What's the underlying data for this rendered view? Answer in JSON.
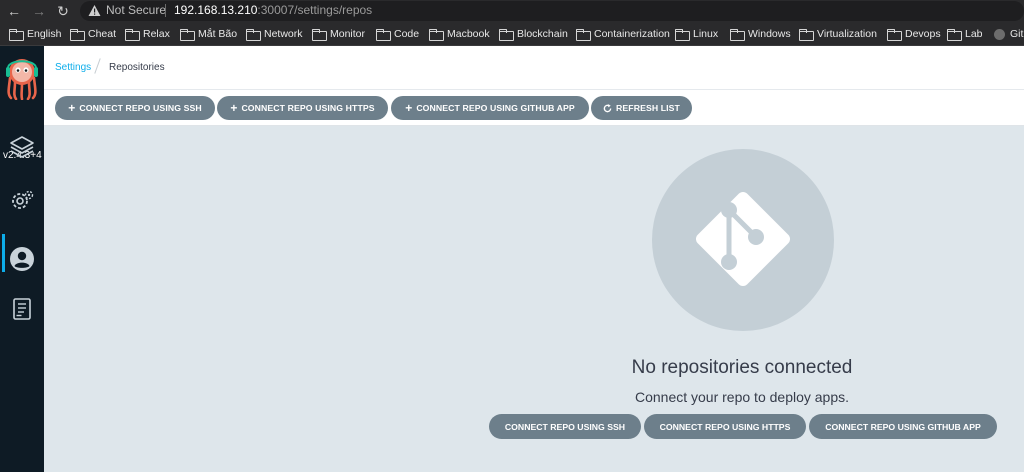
{
  "browser": {
    "security_label": "Not Secure",
    "url_host": "192.168.13.210",
    "url_rest": ":30007/settings/repos",
    "bookmarks": [
      {
        "label": "English",
        "icon": "folder-icon"
      },
      {
        "label": "Cheat",
        "icon": "folder-icon"
      },
      {
        "label": "Relax",
        "icon": "folder-icon"
      },
      {
        "label": "Mắt Bão",
        "icon": "folder-icon"
      },
      {
        "label": "Network",
        "icon": "folder-icon"
      },
      {
        "label": "Monitor",
        "icon": "folder-icon"
      },
      {
        "label": "Code",
        "icon": "folder-icon"
      },
      {
        "label": "Macbook",
        "icon": "folder-icon"
      },
      {
        "label": "Blockchain",
        "icon": "folder-icon"
      },
      {
        "label": "Containerization",
        "icon": "folder-icon"
      },
      {
        "label": "Linux",
        "icon": "folder-icon"
      },
      {
        "label": "Windows",
        "icon": "folder-icon"
      },
      {
        "label": "Virtualization",
        "icon": "folder-icon"
      },
      {
        "label": "Devops",
        "icon": "folder-icon"
      },
      {
        "label": "Lab",
        "icon": "folder-icon"
      },
      {
        "label": "Git",
        "icon": "github-icon"
      }
    ]
  },
  "sidebar": {
    "version": "v2.4.3+4",
    "items": [
      {
        "name": "applications",
        "icon": "layers-icon"
      },
      {
        "name": "settings",
        "icon": "gear-icon",
        "active": true
      },
      {
        "name": "user-info",
        "icon": "user-circle-icon"
      },
      {
        "name": "documentation",
        "icon": "book-icon"
      }
    ],
    "accent": "#0dadea"
  },
  "breadcrumb": {
    "parent": "Settings",
    "current": "Repositories"
  },
  "toolbar": {
    "ssh": "CONNECT REPO USING SSH",
    "https": "CONNECT REPO USING HTTPS",
    "github": "CONNECT REPO USING GITHUB APP",
    "refresh": "REFRESH LIST"
  },
  "empty_state": {
    "icon": "git-icon",
    "title": "No repositories connected",
    "subtitle": "Connect your repo to deploy apps.",
    "ssh": "CONNECT REPO USING SSH",
    "https": "CONNECT REPO USING HTTPS",
    "github": "CONNECT REPO USING GITHUB APP"
  },
  "colors": {
    "button": "#6d7f8b",
    "sidebar_bg": "#0e1b25",
    "content_bg": "#dee6eb"
  }
}
